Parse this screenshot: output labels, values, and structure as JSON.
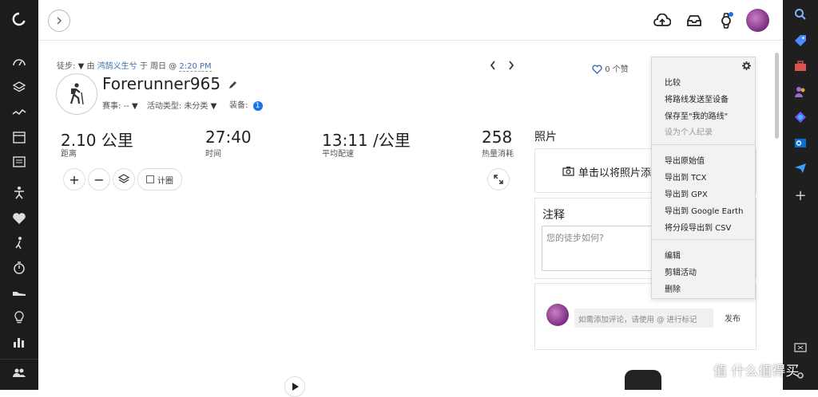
{
  "activity": {
    "type_label": "徒步:",
    "by_label": "由",
    "user_name": "鸿鹄义生兮",
    "at_label": "于 周日 @",
    "time": "2:20 PM",
    "title": "Forerunner965",
    "race_label": "赛事: --",
    "activity_type_label": "活动类型: 未分类",
    "gear_label": "装备:",
    "gear_count": "1",
    "likes": "0 个赞"
  },
  "stats": [
    {
      "value": "2.10 公里",
      "label": "距离"
    },
    {
      "value": "27:40",
      "label": "时间"
    },
    {
      "value": "13:11 /公里",
      "label": "平均配速"
    },
    {
      "value": "258",
      "label": "热量消耗"
    }
  ],
  "map_controls": {
    "zoom_in": "+",
    "zoom_out": "−",
    "timer_label": "计圈"
  },
  "photos": {
    "heading": "照片",
    "upload_label": "单击以将照片添"
  },
  "notes": {
    "heading": "注释",
    "placeholder": "您的徒步如何?"
  },
  "comments": {
    "placeholder": "如需添加评论，请使用 @ 进行标记",
    "post_label": "发布"
  },
  "menu": {
    "group1": [
      "比较",
      "将路线发送至设备",
      "保存至\"我的路线\""
    ],
    "disabled_item": "设为个人纪录",
    "group2": [
      "导出原始值",
      "导出到 TCX",
      "导出到 GPX",
      "导出到 Google Earth",
      "将分段导出到 CSV"
    ],
    "group3": [
      "编辑",
      "剪辑活动",
      "删除"
    ]
  },
  "watermark": "值 什么值得买",
  "colors": {
    "accent": "#3a6fb5",
    "sidebar": "#1c1c1c",
    "badge": "#1a73e8"
  }
}
